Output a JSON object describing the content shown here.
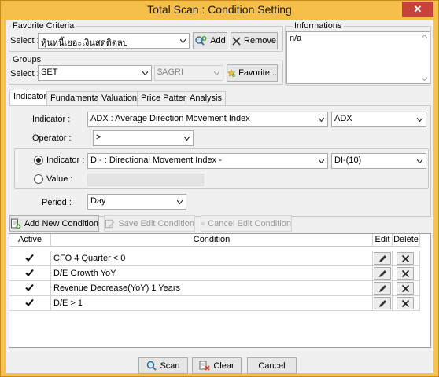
{
  "window": {
    "title": "Total Scan : Condition Setting",
    "close_glyph": "✕"
  },
  "favorite_criteria": {
    "legend": "Favorite Criteria",
    "select_label": "Select :",
    "selected": "หุ้นหนี้เยอะเงินสดติดลบ",
    "add_label": "Add",
    "remove_label": "Remove"
  },
  "informations": {
    "legend": "Informations",
    "text": "n/a"
  },
  "groups": {
    "legend": "Groups",
    "select_label": "Select :",
    "selected": "SET",
    "secondary_selected": "$AGRI",
    "favorite_label": "Favorite..."
  },
  "tabs": [
    {
      "label": "Indicator",
      "active": true
    },
    {
      "label": "Fundamental",
      "active": false
    },
    {
      "label": "Valuation",
      "active": false
    },
    {
      "label": "Price Pattern",
      "active": false
    },
    {
      "label": "Analysis",
      "active": false
    }
  ],
  "indicator_panel": {
    "indicator_label": "Indicator :",
    "indicator_selected": "ADX : Average Direction Movement Index",
    "indicator_short": "ADX",
    "operator_label": "Operator :",
    "operator_selected": ">",
    "compare_indicator_label": "Indicator :",
    "compare_indicator_selected": "DI- : Directional Movement Index -",
    "compare_indicator_param": "DI-(10)",
    "value_label": "Value :",
    "value": "",
    "period_label": "Period :",
    "period_selected": "Day"
  },
  "condition_toolbar": {
    "add_label": "Add New Condition",
    "save_label": "Save Edit Condition",
    "cancel_label": "Cancel Edit Condition"
  },
  "conditions_table": {
    "headers": {
      "active": "Active",
      "condition": "Condition",
      "edit": "Edit",
      "delete": "Delete"
    },
    "rows": [
      {
        "active": true,
        "condition": "CFO 4 Quarter < 0"
      },
      {
        "active": true,
        "condition": "D/E Growth YoY"
      },
      {
        "active": true,
        "condition": "Revenue Decrease(YoY) 1 Years"
      },
      {
        "active": true,
        "condition": "D/E > 1"
      }
    ]
  },
  "footer": {
    "scan_label": "Scan",
    "clear_label": "Clear",
    "cancel_label": "Cancel"
  },
  "colors": {
    "title_bar": "#f6bf4a",
    "close_button": "#c7423b",
    "panel": "#f0f0f0"
  }
}
